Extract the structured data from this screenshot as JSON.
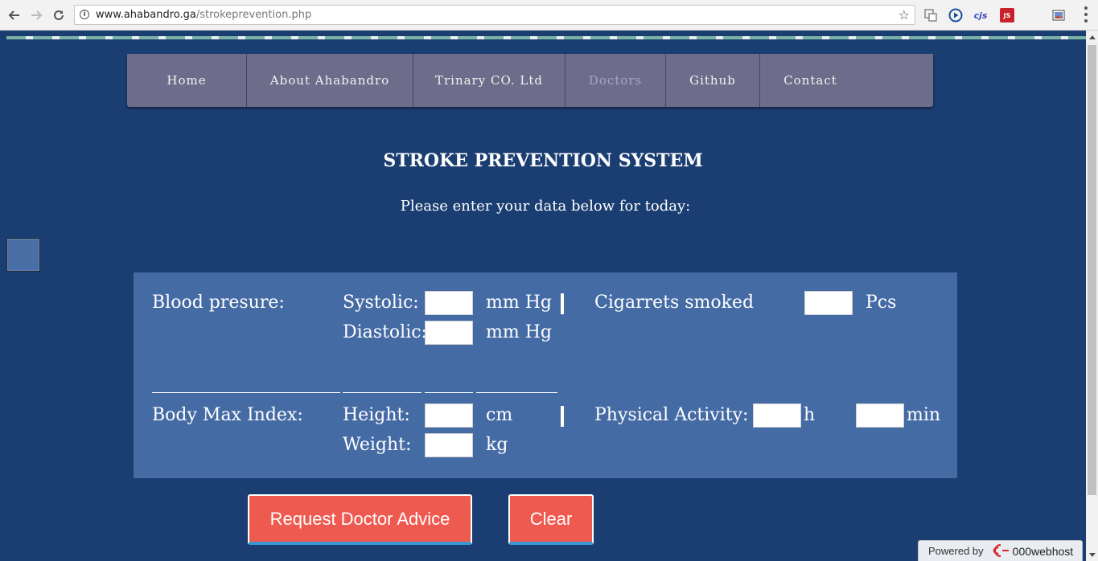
{
  "browser": {
    "url_host": "www.ahabandro.ga",
    "url_path": "/strokeprevention.php",
    "ext_cjs": "cjs",
    "ext_js": "JS"
  },
  "nav": {
    "items": [
      "Home",
      "About Ahabandro",
      "Trinary CO. Ltd",
      "Doctors",
      "Github",
      "Contact"
    ],
    "active": "Doctors"
  },
  "page": {
    "title": "STROKE PREVENTION SYSTEM",
    "subtitle": "Please enter your data below for today:"
  },
  "form": {
    "blood_pressure_label": "Blood presure:",
    "systolic_label": "Systolic:",
    "diastolic_label": "Diastolic:",
    "bp_unit": "mm Hg",
    "cigarettes_label": "Cigarrets smoked",
    "cigarettes_unit": "Pcs",
    "bmi_label": "Body Max Index:",
    "height_label": "Height:",
    "height_unit": "cm",
    "weight_label": "Weight:",
    "weight_unit": "kg",
    "activity_label": "Physical Activity:",
    "activity_hours_unit": "h",
    "activity_minutes_unit": "min",
    "values": {
      "systolic": "",
      "diastolic": "",
      "cigarettes": "",
      "height": "",
      "weight": "",
      "activity_hours": "",
      "activity_minutes": ""
    }
  },
  "buttons": {
    "request": "Request Doctor Advice",
    "clear": "Clear"
  },
  "footer": {
    "powered_by": "Powered by",
    "host": "000webhost"
  },
  "colors": {
    "page_bg": "#1b3e72",
    "panel_bg": "#456ba5",
    "nav_bg": "#6d6d8b",
    "button_bg": "#ef5a50"
  }
}
